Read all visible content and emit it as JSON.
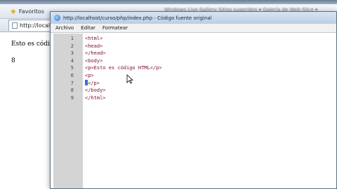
{
  "browser": {
    "favorites_label": "Favoritos",
    "favorites_links": "Windows Live Gallery   Sitios sugeridos ▾   Galería de Web Slice ▾",
    "tab_title": "http://localh",
    "page_text": "Esto es códig",
    "page_number": "8"
  },
  "source_window": {
    "title": "http://localhost/curso/php/index.php - Código fuente original",
    "menu": [
      "Archivo",
      "Editar",
      "Formatear"
    ],
    "lines": [
      {
        "n": "1",
        "code": "<html>"
      },
      {
        "n": "2",
        "code": "<head>"
      },
      {
        "n": "3",
        "code": "</head>"
      },
      {
        "n": "4",
        "code": "<body>"
      },
      {
        "n": "5",
        "code": "<p>Esto es código HTML</p>"
      },
      {
        "n": "6",
        "code": "<p>"
      },
      {
        "n": "7",
        "code": "</p>",
        "caret": true
      },
      {
        "n": "8",
        "code": "</body>"
      },
      {
        "n": "9",
        "code": "</html>"
      }
    ]
  },
  "colors": {
    "code_text": "#7a0f2e",
    "gutter": "#d4d4d4",
    "caret": "#3c6fd1"
  }
}
